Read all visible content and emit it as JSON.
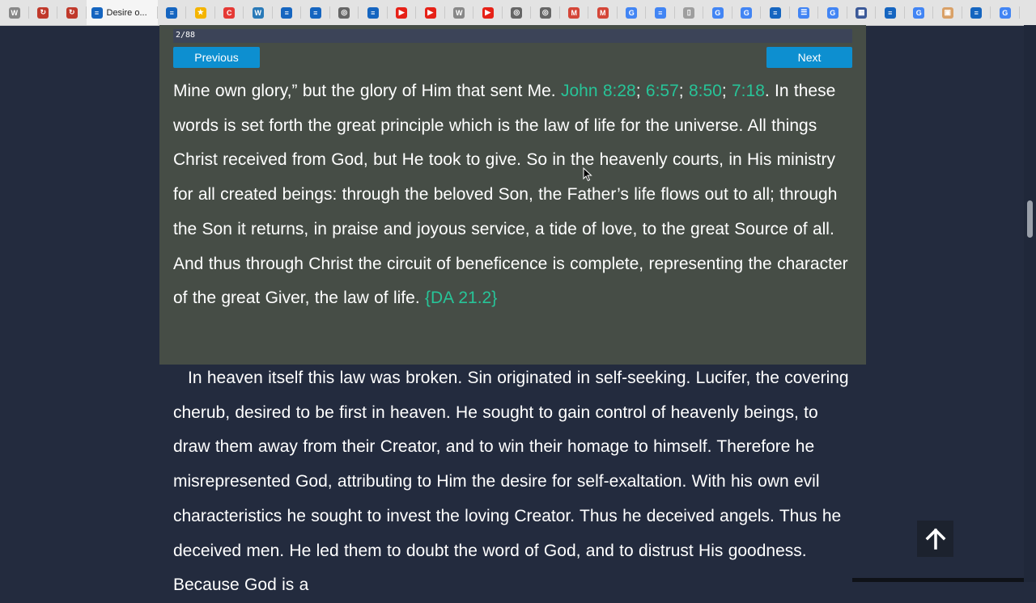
{
  "browser": {
    "active_tab_title": "Desire o...",
    "tabs": [
      {
        "icon": "w-icon",
        "glyph": "W",
        "color": "#888888"
      },
      {
        "icon": "refresh-red-icon",
        "glyph": "↻",
        "color": "#c0392b"
      },
      {
        "icon": "refresh-red-icon",
        "glyph": "↻",
        "color": "#c0392b"
      },
      {
        "icon": "active",
        "glyph": "",
        "color": "#1565c0"
      },
      {
        "icon": "egw-icon",
        "glyph": "≡",
        "color": "#1565c0"
      },
      {
        "icon": "star-icon",
        "glyph": "★",
        "color": "#f4b400"
      },
      {
        "icon": "c-icon",
        "glyph": "C",
        "color": "#e53935"
      },
      {
        "icon": "wordpress-icon",
        "glyph": "W",
        "color": "#2a7ab8"
      },
      {
        "icon": "egw-icon",
        "glyph": "≡",
        "color": "#1565c0"
      },
      {
        "icon": "egw-icon",
        "glyph": "≡",
        "color": "#1565c0"
      },
      {
        "icon": "openai-icon",
        "glyph": "◎",
        "color": "#666666"
      },
      {
        "icon": "egw-icon",
        "glyph": "≡",
        "color": "#1565c0"
      },
      {
        "icon": "youtube-icon",
        "glyph": "▶",
        "color": "#e62117"
      },
      {
        "icon": "youtube-icon",
        "glyph": "▶",
        "color": "#e62117"
      },
      {
        "icon": "w-icon",
        "glyph": "W",
        "color": "#888888"
      },
      {
        "icon": "youtube-icon",
        "glyph": "▶",
        "color": "#e62117"
      },
      {
        "icon": "openai-icon",
        "glyph": "◎",
        "color": "#666666"
      },
      {
        "icon": "openai-icon",
        "glyph": "◎",
        "color": "#666666"
      },
      {
        "icon": "gmail-icon",
        "glyph": "M",
        "color": "#d44638"
      },
      {
        "icon": "gmail-icon",
        "glyph": "M",
        "color": "#d44638"
      },
      {
        "icon": "google-icon",
        "glyph": "G",
        "color": "#4285f4"
      },
      {
        "icon": "docs-icon",
        "glyph": "≡",
        "color": "#4285f4"
      },
      {
        "icon": "file-icon",
        "glyph": "▯",
        "color": "#9e9e9e"
      },
      {
        "icon": "google-icon",
        "glyph": "G",
        "color": "#4285f4"
      },
      {
        "icon": "google-icon",
        "glyph": "G",
        "color": "#4285f4"
      },
      {
        "icon": "egw-icon",
        "glyph": "≡",
        "color": "#1565c0"
      },
      {
        "icon": "list-icon",
        "glyph": "☰",
        "color": "#4285f4"
      },
      {
        "icon": "google-icon",
        "glyph": "G",
        "color": "#4285f4"
      },
      {
        "icon": "grid-icon",
        "glyph": "▦",
        "color": "#3b5998"
      },
      {
        "icon": "egw-icon",
        "glyph": "≡",
        "color": "#1565c0"
      },
      {
        "icon": "google-icon",
        "glyph": "G",
        "color": "#4285f4"
      },
      {
        "icon": "photo-icon",
        "glyph": "▣",
        "color": "#d9a066"
      },
      {
        "icon": "egw-icon",
        "glyph": "≡",
        "color": "#1565c0"
      },
      {
        "icon": "google-icon",
        "glyph": "G",
        "color": "#4285f4"
      }
    ]
  },
  "reader": {
    "progress_label": "2/88",
    "progress_fraction": 0.0227,
    "previous_label": "Previous",
    "next_label": "Next",
    "p1": {
      "a": "Mine own glory,” but the glory of Him that sent Me. ",
      "ref1": "John 8:28",
      "s1": "; ",
      "ref2": "6:57",
      "s2": "; ",
      "ref3": "8:50",
      "s3": "; ",
      "ref4": "7:18",
      "b": ". In these words is set forth the great principle which is the law of life for the universe. All things Christ received from God, but He took to give. So in the heavenly courts, in His ministry for all created beings: through the beloved Son, the Father’s life flows out to all; through the Son it returns, in praise and joyous service, a tide of love, to the great Source of all. And thus through Christ the circuit of beneficence is complete, representing the character of the great Giver, the law of life. ",
      "citation": "{DA 21.2}"
    },
    "p2": "In heaven itself this law was broken. Sin originated in self-seeking. Lucifer, the covering cherub, desired to be first in heaven. He sought to gain control of heavenly beings, to draw them away from their Creator, and to win their homage to himself. Therefore he misrepresented God, attributing to Him the desire for self-exaltation. With his own evil characteristics he sought to invest the loving Creator. Thus he deceived angels. Thus he deceived men. He led them to doubt the word of God, and to distrust His goodness. Because God is a"
  },
  "colors": {
    "background": "#232b3e",
    "highlight_panel": "#464d46",
    "button": "#0d8fd0",
    "reference": "#27c498"
  }
}
